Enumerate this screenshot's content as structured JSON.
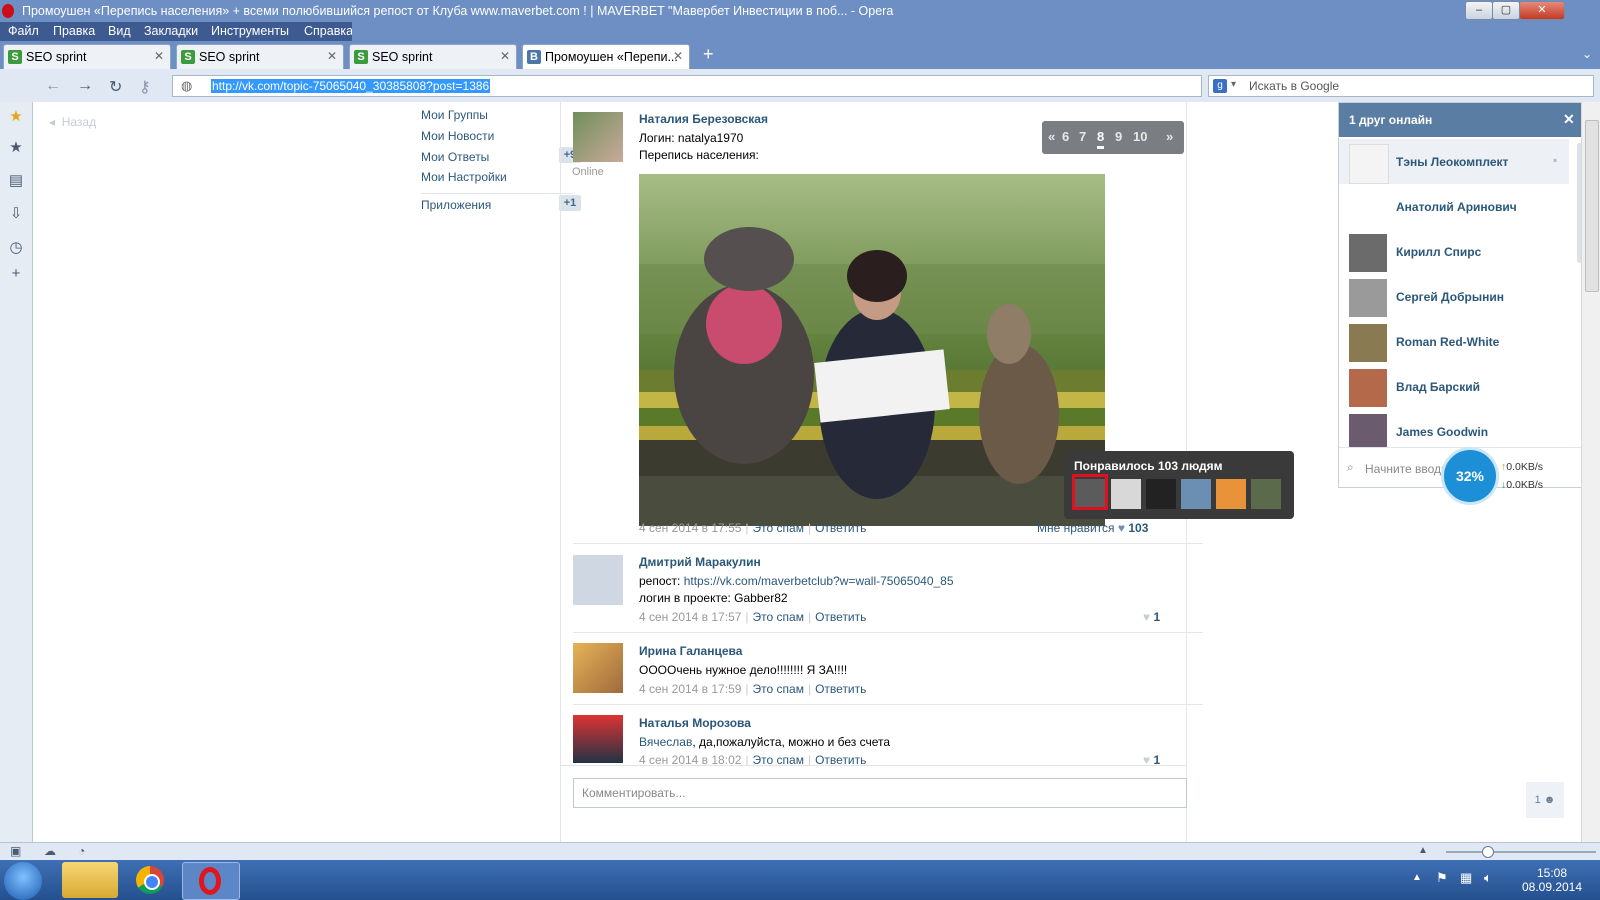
{
  "window": {
    "title": "Промоушен «Перепись населения» + всеми полюбившийся репост от Клуба www.maverbet.com ! | MAVERBET \"Мавербет Инвестиции в поб... - Opera"
  },
  "menu": [
    "Файл",
    "Правка",
    "Вид",
    "Закладки",
    "Инструменты",
    "Справка"
  ],
  "tabs": [
    {
      "label": "SEO sprint",
      "favicon": "S"
    },
    {
      "label": "SEO sprint",
      "favicon": "S"
    },
    {
      "label": "SEO sprint",
      "favicon": "S"
    },
    {
      "label": "Промоушен «Перепи...",
      "favicon": "B"
    }
  ],
  "address": {
    "url": "http://vk.com/topic-75065040_30385808?post=1386",
    "search_placeholder": "Искать в Google"
  },
  "page": {
    "back_label": "Назад",
    "left_nav": [
      {
        "label": "Мои Группы",
        "badge": ""
      },
      {
        "label": "Мои Новости",
        "badge": ""
      },
      {
        "label": "Мои Ответы",
        "badge": "+9"
      },
      {
        "label": "Мои Настройки",
        "badge": ""
      }
    ],
    "apps": {
      "label": "Приложения",
      "badge": "+1"
    },
    "pager": {
      "prev": "«",
      "pages": [
        "6",
        "7",
        "8",
        "9",
        "10"
      ],
      "current": "8",
      "next": "»"
    },
    "posts": [
      {
        "author": "Наталия Березовская",
        "status": "Online",
        "lines": [
          "Логин: natalya1970",
          "Перепись населения:"
        ],
        "date": "4 сен 2014 в 17:55",
        "spam": "Это спам",
        "reply": "Ответить",
        "like_label": "Мне нравится",
        "likes": "103"
      },
      {
        "author": "Дмитрий Маракулин",
        "repost_prefix": "репост:",
        "repost_link": "https://vk.com/maverbetclub?w=wall-75065040_85",
        "lines": [
          "логин в проекте: Gabber82"
        ],
        "date": "4 сен 2014 в 17:57",
        "spam": "Это спам",
        "reply": "Ответить",
        "likes": "1"
      },
      {
        "author": "Ирина Галанцева",
        "lines": [
          "ООООчень нужное дело!!!!!!!! Я ЗА!!!!"
        ],
        "date": "4 сен 2014 в 17:59",
        "spam": "Это спам",
        "reply": "Ответить"
      },
      {
        "author": "Наталья Морозова",
        "mention": "Вячеслав",
        "text": ", да,пожалуйста, можно и без счета",
        "date": "4 сен 2014 в 18:02",
        "spam": "Это спам",
        "reply": "Ответить",
        "likes": "1"
      }
    ],
    "likes_popup": {
      "title": "Понравилось 103 людям"
    },
    "comment_placeholder": "Комментировать..."
  },
  "friends": {
    "header": "1 друг онлайн",
    "list": [
      "Тэны Леокомплект",
      "Анатолий Аринович",
      "Кирилл Спирс",
      "Сергей Добрынин",
      "Roman Red-White",
      "Влад Барский",
      "James Goodwin"
    ],
    "search_placeholder": "Начните вводить имя.."
  },
  "net": {
    "percent": "32%",
    "up": "0.0KB/s",
    "down": "0.0KB/s"
  },
  "online_count": "1",
  "clock": {
    "time": "15:08",
    "date": "08.09.2014"
  },
  "colors": {
    "vk_link": "#2b587a",
    "vk_header": "#597da3",
    "highlight": "#e01020"
  }
}
